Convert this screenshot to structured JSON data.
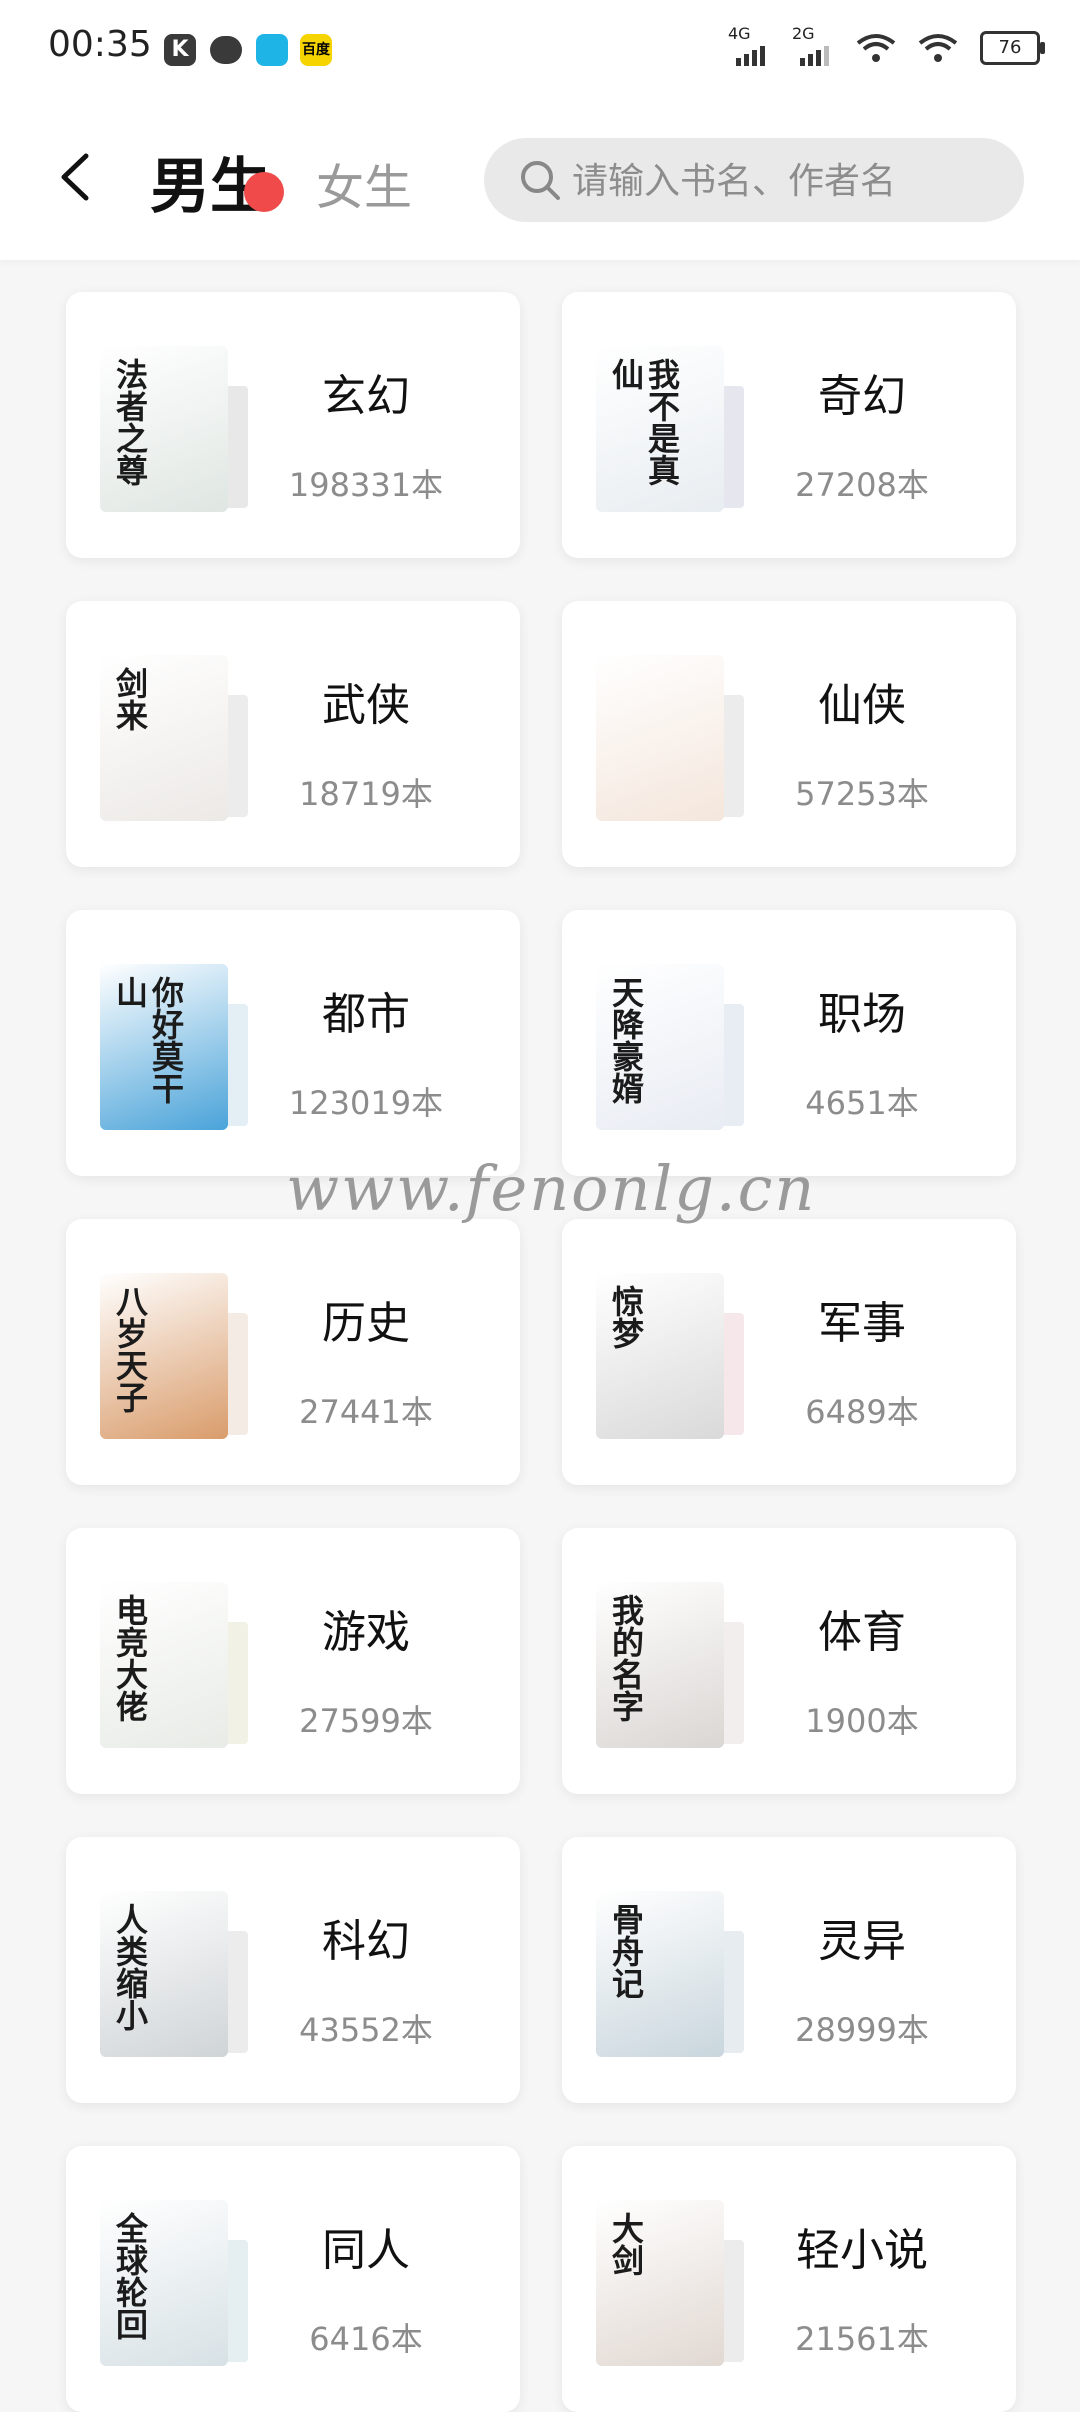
{
  "status_bar": {
    "time": "00:35",
    "app_k": "K",
    "app_yellow": "百度",
    "net1": "4G",
    "net2": "2G",
    "battery": "76"
  },
  "header": {
    "tab_male": "男生",
    "tab_female": "女生",
    "search_placeholder": "请输入书名、作者名"
  },
  "categories": [
    {
      "name": "玄幻",
      "count": "198331本",
      "cover_title": "法者之尊",
      "cover_color": "#dfe6e2",
      "accent": "#e8e8e8"
    },
    {
      "name": "奇幻",
      "count": "27208本",
      "cover_title": "我不是真仙",
      "cover_color": "#e8edf1",
      "accent": "#e6e6ee"
    },
    {
      "name": "武侠",
      "count": "18719本",
      "cover_title": "剑来",
      "cover_color": "#ece9e6",
      "accent": "#ececec"
    },
    {
      "name": "仙侠",
      "count": "57253本",
      "cover_title": "",
      "cover_color": "#f4e6dc",
      "accent": "#ececec"
    },
    {
      "name": "都市",
      "count": "123019本",
      "cover_title": "你好莫干山",
      "cover_color": "#4aa3d9",
      "accent": "#e4eef5"
    },
    {
      "name": "职场",
      "count": "4651本",
      "cover_title": "天降豪婿",
      "cover_color": "#e8ecf3",
      "accent": "#e8ecf3"
    },
    {
      "name": "历史",
      "count": "27441本",
      "cover_title": "八岁天子",
      "cover_color": "#d99c6b",
      "accent": "#f4ece4"
    },
    {
      "name": "军事",
      "count": "6489本",
      "cover_title": "惊梦",
      "cover_color": "#d9d9d9",
      "accent": "#f6e8ea"
    },
    {
      "name": "游戏",
      "count": "27599本",
      "cover_title": "电竞大佬",
      "cover_color": "#e8ebe6",
      "accent": "#f1f1e6"
    },
    {
      "name": "体育",
      "count": "1900本",
      "cover_title": "我的名字",
      "cover_color": "#dad6d3",
      "accent": "#f3eeee"
    },
    {
      "name": "科幻",
      "count": "43552本",
      "cover_title": "人类缩小",
      "cover_color": "#cfd4d6",
      "accent": "#ececec"
    },
    {
      "name": "灵异",
      "count": "28999本",
      "cover_title": "骨舟记",
      "cover_color": "#c9d6dd",
      "accent": "#e6ecf0"
    },
    {
      "name": "同人",
      "count": "6416本",
      "cover_title": "全球轮回",
      "cover_color": "#d7e1e5",
      "accent": "#e5eef0"
    },
    {
      "name": "轻小说",
      "count": "21561本",
      "cover_title": "大剑",
      "cover_color": "#e1d8d2",
      "accent": "#ececec"
    }
  ],
  "watermark": "www.fenonlg.cn"
}
